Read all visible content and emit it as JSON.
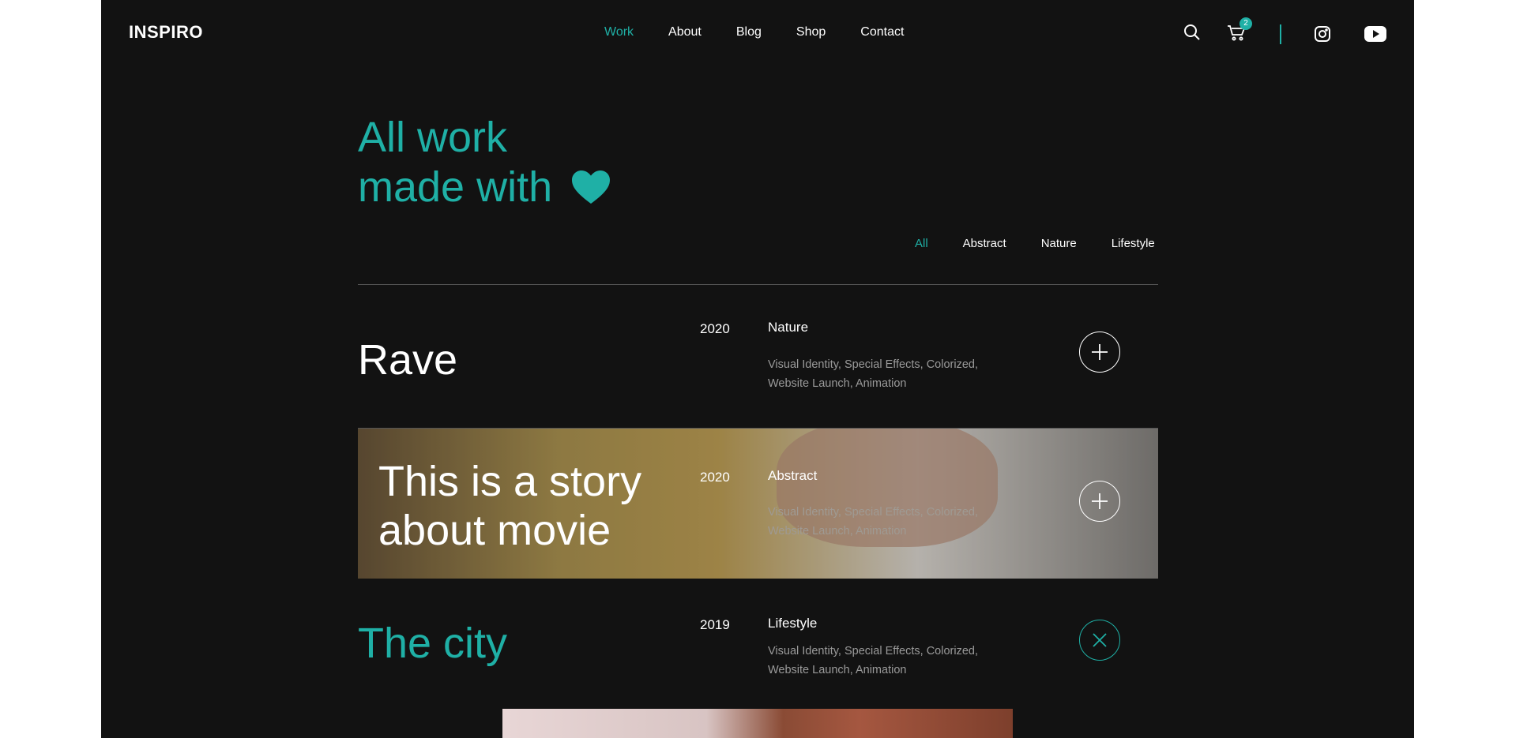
{
  "header": {
    "logo": "INSPIRO",
    "nav": [
      "Work",
      "About",
      "Blog",
      "Shop",
      "Contact"
    ],
    "active_nav": "Work",
    "cart_count": "2",
    "icons": [
      "search-icon",
      "cart-icon",
      "instagram-icon",
      "youtube-icon"
    ]
  },
  "hero": {
    "line1": "All work",
    "line2": "made with"
  },
  "filters": [
    "All",
    "Abstract",
    "Nature",
    "Lifestyle"
  ],
  "projects": [
    {
      "title": "Rave",
      "year": "2020",
      "category": "Nature",
      "tags": "Visual Identity, Special Effects, Colorized, Website Launch, Animation",
      "action": "plus"
    },
    {
      "title": "This is a story about movie",
      "year": "2020",
      "category": "Abstract",
      "tags": "Visual Identity, Special Effects, Colorized, Website Launch, Animation",
      "action": "plus"
    },
    {
      "title": "The city",
      "year": "2019",
      "category": "Lifestyle",
      "tags": "Visual Identity, Special Effects, Colorized, Website Launch, Animation",
      "action": "close"
    }
  ],
  "colors": {
    "accent": "#1fb0a6",
    "background": "#121212",
    "text": "#ffffff",
    "muted": "#9a9a9a"
  }
}
